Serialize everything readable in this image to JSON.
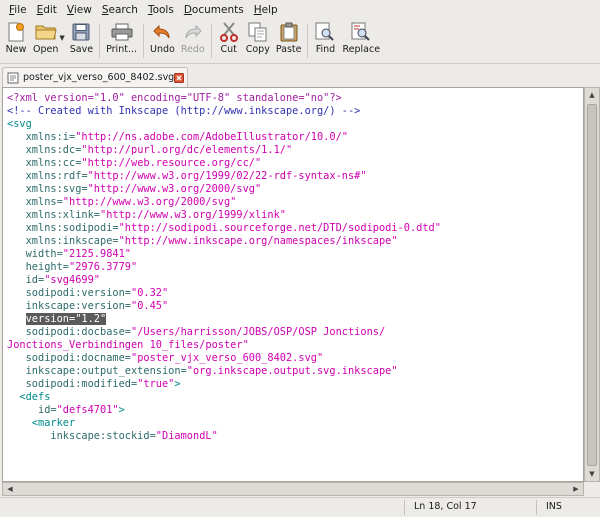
{
  "menubar": {
    "items": [
      {
        "mnemonic": "F",
        "rest": "ile"
      },
      {
        "mnemonic": "E",
        "rest": "dit"
      },
      {
        "mnemonic": "V",
        "rest": "iew"
      },
      {
        "mnemonic": "S",
        "rest": "earch"
      },
      {
        "mnemonic": "T",
        "rest": "ools"
      },
      {
        "mnemonic": "D",
        "rest": "ocuments"
      },
      {
        "mnemonic": "H",
        "rest": "elp"
      }
    ]
  },
  "toolbar": {
    "new_label": "New",
    "open_label": "Open",
    "save_label": "Save",
    "print_label": "Print...",
    "undo_label": "Undo",
    "redo_label": "Redo",
    "cut_label": "Cut",
    "copy_label": "Copy",
    "paste_label": "Paste",
    "find_label": "Find",
    "replace_label": "Replace"
  },
  "tab": {
    "filename": "poster_vjx_verso_600_8402.svg"
  },
  "editor": {
    "lines": [
      [
        {
          "t": "<?xml version=\"1.0\" encoding=\"UTF-8\" standalone=\"no\"?>",
          "c": "t-purple"
        }
      ],
      [
        {
          "t": "<!-- Created with Inkscape (http://www.inkscape.org/) -->",
          "c": "t-blue"
        }
      ],
      [
        {
          "t": "<svg",
          "c": "t-teal"
        }
      ],
      [
        {
          "t": "   xmlns:i=",
          "c": "t-attr"
        },
        {
          "t": "\"http://ns.adobe.com/AdobeIllustrator/10.0/\"",
          "c": "t-pink"
        }
      ],
      [
        {
          "t": "   xmlns:dc=",
          "c": "t-attr"
        },
        {
          "t": "\"http://purl.org/dc/elements/1.1/\"",
          "c": "t-pink"
        }
      ],
      [
        {
          "t": "   xmlns:cc=",
          "c": "t-attr"
        },
        {
          "t": "\"http://web.resource.org/cc/\"",
          "c": "t-pink"
        }
      ],
      [
        {
          "t": "   xmlns:rdf=",
          "c": "t-attr"
        },
        {
          "t": "\"http://www.w3.org/1999/02/22-rdf-syntax-ns#\"",
          "c": "t-pink"
        }
      ],
      [
        {
          "t": "   xmlns:svg=",
          "c": "t-attr"
        },
        {
          "t": "\"http://www.w3.org/2000/svg\"",
          "c": "t-pink"
        }
      ],
      [
        {
          "t": "   xmlns=",
          "c": "t-attr"
        },
        {
          "t": "\"http://www.w3.org/2000/svg\"",
          "c": "t-pink"
        }
      ],
      [
        {
          "t": "   xmlns:xlink=",
          "c": "t-attr"
        },
        {
          "t": "\"http://www.w3.org/1999/xlink\"",
          "c": "t-pink"
        }
      ],
      [
        {
          "t": "   xmlns:sodipodi=",
          "c": "t-attr"
        },
        {
          "t": "\"http://sodipodi.sourceforge.net/DTD/sodipodi-0.dtd\"",
          "c": "t-pink"
        }
      ],
      [
        {
          "t": "   xmlns:inkscape=",
          "c": "t-attr"
        },
        {
          "t": "\"http://www.inkscape.org/namespaces/inkscape\"",
          "c": "t-pink"
        }
      ],
      [
        {
          "t": "   width=",
          "c": "t-attr"
        },
        {
          "t": "\"2125.9841\"",
          "c": "t-pink"
        }
      ],
      [
        {
          "t": "   height=",
          "c": "t-attr"
        },
        {
          "t": "\"2976.3779\"",
          "c": "t-pink"
        }
      ],
      [
        {
          "t": "   id=",
          "c": "t-attr"
        },
        {
          "t": "\"svg4699\"",
          "c": "t-pink"
        }
      ],
      [
        {
          "t": "   sodipodi:version=",
          "c": "t-attr"
        },
        {
          "t": "\"0.32\"",
          "c": "t-pink"
        }
      ],
      [
        {
          "t": "   inkscape:version=",
          "c": "t-attr"
        },
        {
          "t": "\"0.45\"",
          "c": "t-pink"
        }
      ],
      [
        {
          "t": "   ",
          "c": "t-plain"
        },
        {
          "t": "version=\"1.2\"",
          "c": "sel"
        }
      ],
      [
        {
          "t": "   sodipodi:docbase=",
          "c": "t-attr"
        },
        {
          "t": "\"/Users/harrisson/JOBS/OSP/OSP Jonctions/",
          "c": "t-pink"
        }
      ],
      [
        {
          "t": "Jonctions_Verbindingen 10_files/poster\"",
          "c": "t-pink"
        }
      ],
      [
        {
          "t": "   sodipodi:docname=",
          "c": "t-attr"
        },
        {
          "t": "\"poster_vjx_verso_600_8402.svg\"",
          "c": "t-pink"
        }
      ],
      [
        {
          "t": "   inkscape:output_extension=",
          "c": "t-attr"
        },
        {
          "t": "\"org.inkscape.output.svg.inkscape\"",
          "c": "t-pink"
        }
      ],
      [
        {
          "t": "   sodipodi:modified=",
          "c": "t-attr"
        },
        {
          "t": "\"true\"",
          "c": "t-pink"
        },
        {
          "t": ">",
          "c": "t-teal"
        }
      ],
      [
        {
          "t": "  <defs",
          "c": "t-teal"
        }
      ],
      [
        {
          "t": "     id=",
          "c": "t-attr"
        },
        {
          "t": "\"defs4701\"",
          "c": "t-pink"
        },
        {
          "t": ">",
          "c": "t-teal"
        }
      ],
      [
        {
          "t": "    <marker",
          "c": "t-teal"
        }
      ],
      [
        {
          "t": "       inkscape:stockid=",
          "c": "t-attr"
        },
        {
          "t": "\"DiamondL\"",
          "c": "t-pink"
        }
      ]
    ]
  },
  "status": {
    "position": "Ln 18, Col 17",
    "mode": "INS"
  }
}
